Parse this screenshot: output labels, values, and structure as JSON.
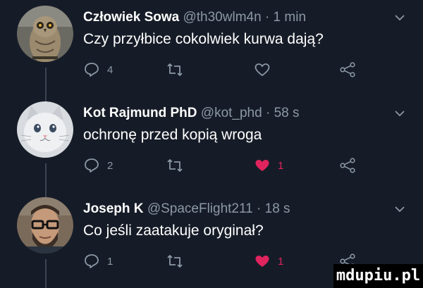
{
  "tweets": [
    {
      "name": "Człowiek Sowa",
      "handle": "@th30wlm4n",
      "time": "· 1 min",
      "text": "Czy przyłbice cokolwiek kurwa dają?",
      "replies": "4",
      "retweets": "",
      "likes": "",
      "liked": false,
      "avatar_icon": "owl-avatar"
    },
    {
      "name": "Kot Rajmund PhD",
      "handle": "@kot_phd",
      "time": "· 58 s",
      "text": "ochronę przed kopią wroga",
      "replies": "2",
      "retweets": "",
      "likes": "1",
      "liked": true,
      "avatar_icon": "cat-avatar"
    },
    {
      "name": "Joseph K",
      "handle": "@SpaceFlight211",
      "time": "· 18 s",
      "text": "Co jeśli zaatakuje oryginał?",
      "replies": "1",
      "retweets": "",
      "likes": "1",
      "liked": true,
      "avatar_icon": "bearded-man-avatar"
    }
  ],
  "colors": {
    "background": "#161c27",
    "secondary_text": "#8b98a5",
    "like_active": "#e0245e"
  },
  "watermark": "mdupiu.pl"
}
